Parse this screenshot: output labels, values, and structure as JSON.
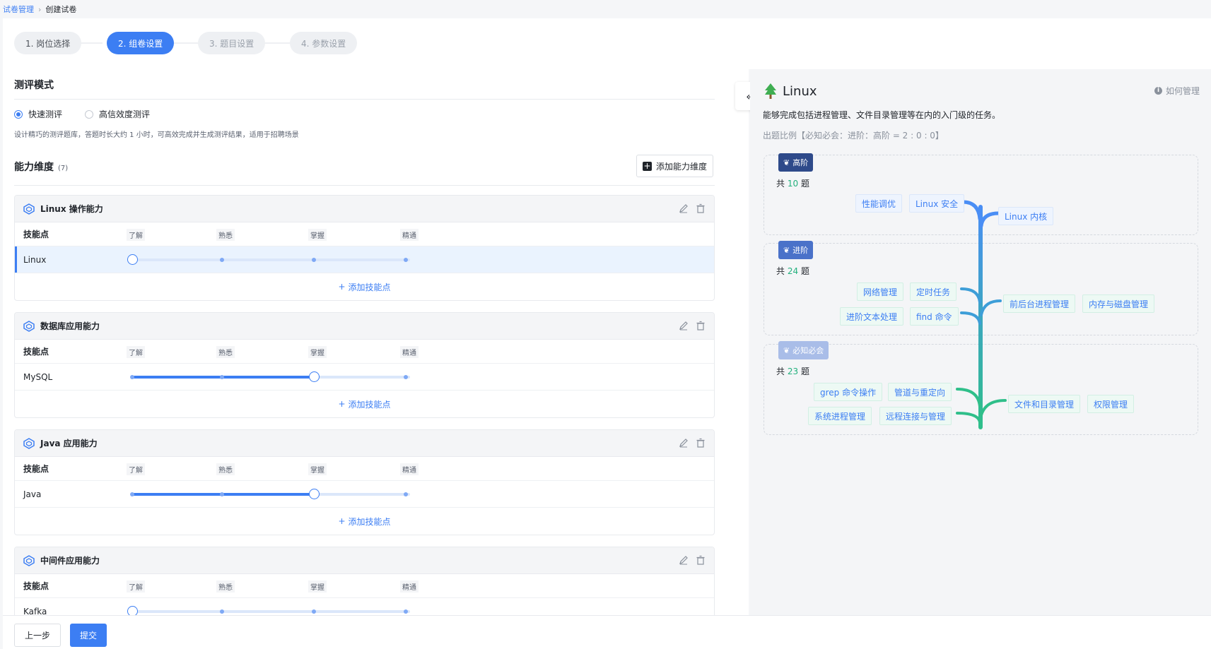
{
  "breadcrumb": {
    "parent": "试卷管理",
    "current": "创建试卷"
  },
  "steps": [
    {
      "label": "1. 岗位选择",
      "state": "done"
    },
    {
      "label": "2. 组卷设置",
      "state": "active"
    },
    {
      "label": "3. 题目设置",
      "state": "disabled"
    },
    {
      "label": "4. 参数设置",
      "state": "disabled"
    }
  ],
  "mode": {
    "title": "测评模式",
    "options": [
      {
        "label": "快速测评",
        "checked": true
      },
      {
        "label": "高信效度测评",
        "checked": false
      }
    ],
    "description": "设计精巧的测评题库，答题时长大约 1 小时，可高效完成并生成测评结果，适用于招聘场景"
  },
  "abilities": {
    "title": "能力维度",
    "count": "(7)",
    "add_label": "添加能力维度",
    "skill_header": "技能点",
    "levels": [
      "了解",
      "熟悉",
      "掌握",
      "精通"
    ],
    "add_skill_label": "添加技能点",
    "cards": [
      {
        "title": "Linux 操作能力",
        "skill": "Linux",
        "level": 0,
        "selected": true
      },
      {
        "title": "数据库应用能力",
        "skill": "MySQL",
        "level": 2,
        "selected": false
      },
      {
        "title": "Java 应用能力",
        "skill": "Java",
        "level": 2,
        "selected": false
      },
      {
        "title": "中间件应用能力",
        "skill": "Kafka",
        "level": 0,
        "selected": false
      }
    ]
  },
  "panel": {
    "title": "Linux",
    "help": "如何管理",
    "description": "能够完成包括进程管理、文件目录管理等在内的入门级的任务。",
    "ratio": "出题比例【必知必会：进阶：高阶 = 2 : 0 : 0】",
    "tiers": [
      {
        "badge": "高阶",
        "color": "#2e4a8a",
        "count_prefix": "共",
        "count": "10",
        "count_suffix": "题",
        "left_tags": [
          "性能调优",
          "Linux 安全"
        ],
        "right_tags": [
          "Linux 内核"
        ]
      },
      {
        "badge": "进阶",
        "color": "#4a72c9",
        "count_prefix": "共",
        "count": "24",
        "count_suffix": "题",
        "left_tags": [
          "网络管理",
          "定时任务",
          "进阶文本处理",
          "find 命令"
        ],
        "right_tags": [
          "前后台进程管理",
          "内存与磁盘管理"
        ]
      },
      {
        "badge": "必知必会",
        "color": "#a9bde8",
        "count_prefix": "共",
        "count": "23",
        "count_suffix": "题",
        "left_tags": [
          "grep 命令操作",
          "管道与重定向",
          "系统进程管理",
          "远程连接与管理"
        ],
        "right_tags": [
          "文件和目录管理",
          "权限管理"
        ]
      }
    ]
  },
  "footer": {
    "prev": "上一步",
    "submit": "提交"
  }
}
